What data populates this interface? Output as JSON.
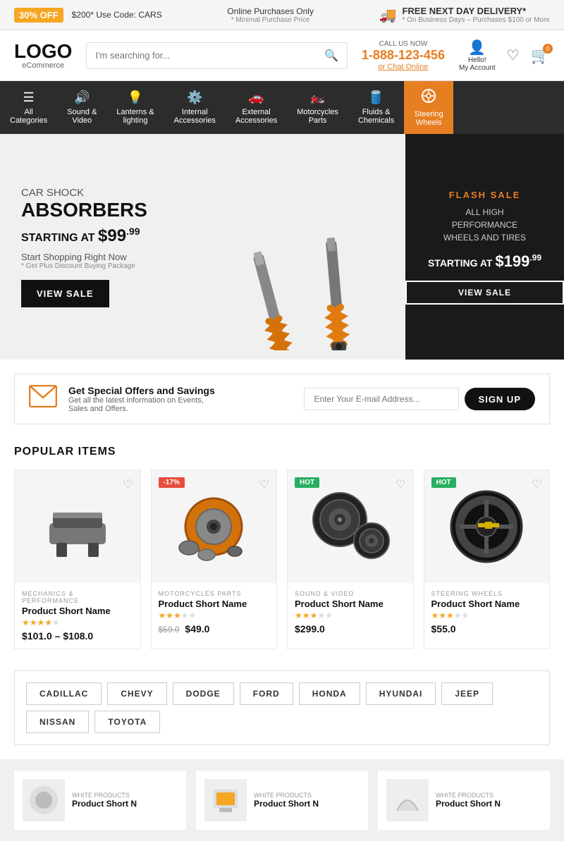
{
  "topBanner": {
    "saleText": "30% OFF",
    "promoCode": "$200* Use Code: CARS",
    "onlinePurchases": "Online Purchases Only",
    "minPurchase": "* Minimal Purchase Price",
    "deliveryTitle": "FREE NEXT DAY DELIVERY*",
    "deliveryNote": "* On Business Days – Purchases $100 or More",
    "truckIcon": "🚚"
  },
  "header": {
    "logoText": "LOGO",
    "logoSub": "eCommerce",
    "searchPlaceholder": "I'm searching for...",
    "callLabel": "CALL US NOW",
    "phone": "1-888-123-456",
    "chatLabel": "or Chat Online",
    "helloLabel": "Hello!",
    "myAccount": "My Account",
    "cartCount": "0",
    "personIcon": "👤",
    "heartIcon": "♡",
    "cartIcon": "🛒"
  },
  "nav": {
    "items": [
      {
        "label": "All\nCategories",
        "icon": "☰",
        "name": "all-categories"
      },
      {
        "label": "Sound &\nVideo",
        "icon": "🔊",
        "name": "sound-video"
      },
      {
        "label": "Lanterns &\nlighting",
        "icon": "💡",
        "name": "lanterns-lighting"
      },
      {
        "label": "Internal\nAccessories",
        "icon": "🔘",
        "name": "internal-accessories"
      },
      {
        "label": "External\nAccessories",
        "icon": "🚗",
        "name": "external-accessories"
      },
      {
        "label": "Motorcycles\nParts",
        "icon": "🚲",
        "name": "motorcycles-parts"
      },
      {
        "label": "Fluids &\nChemicals",
        "icon": "🔧",
        "name": "fluids-chemicals"
      },
      {
        "label": "Steering\nWheels",
        "icon": "⊙",
        "name": "steering-wheels",
        "active": true
      }
    ]
  },
  "hero": {
    "left": {
      "subtitle": "CAR SHOCK",
      "title": "ABSORBERS",
      "pricePre": "STARTING AT ",
      "priceDollar": "$99",
      "priceCents": ".99",
      "tagline": "Start Shopping Right Now",
      "disclaimer": "* Get Plus Discount Buying Package",
      "btnLabel": "VIEW SALE"
    },
    "right": {
      "flashLabel": "FLASH SALE",
      "flashDesc": "ALL HIGH\nPERFORMANCE\nWHEELS AND TIRES",
      "priceLabel": "STARTING AT ",
      "priceDollar": "$199",
      "priceCents": ".99",
      "btnLabel": "VIEW SALE"
    }
  },
  "newsletter": {
    "heading": "Get Special Offers and Savings",
    "subtext": "Get all the latest information on Events,\nSales and Offers.",
    "inputPlaceholder": "Enter Your E-mail Address...",
    "btnLabel": "SIGN UP"
  },
  "popular": {
    "heading": "POPULAR ITEMS",
    "products": [
      {
        "badge": null,
        "category": "MECHANICS & PERFORMANCE",
        "name": "Product Short Name",
        "stars": 4,
        "totalStars": 5,
        "price": "$101.0 – $108.0",
        "oldPrice": null,
        "color": "#b0b0b0"
      },
      {
        "badge": "-17%",
        "badgeType": "sale",
        "category": "MOTORCYCLES PARTS",
        "name": "Product Short Name",
        "stars": 3,
        "totalStars": 5,
        "price": "$49.0",
        "oldPrice": "$59.0",
        "color": "#c0603a"
      },
      {
        "badge": "HOT",
        "badgeType": "hot",
        "category": "SOUND & VIDEO",
        "name": "Product Short Name",
        "stars": 3,
        "totalStars": 5,
        "price": "$299.0",
        "oldPrice": null,
        "color": "#333333"
      },
      {
        "badge": "HOT",
        "badgeType": "hot",
        "category": "STEERING WHEELS",
        "name": "Product Short Name",
        "stars": 3,
        "totalStars": 5,
        "price": "$55.0",
        "oldPrice": null,
        "color": "#111111"
      }
    ]
  },
  "brands": {
    "items": [
      "CADILLAC",
      "CHEVY",
      "DODGE",
      "FORD",
      "HONDA",
      "HYUNDAI",
      "JEEP",
      "NISSAN",
      "TOYOTA"
    ]
  },
  "bottomProducts": [
    {
      "label": "WHITE PRODUCTS",
      "name": "Product Short N"
    },
    {
      "label": "WHITE PRODUCTS",
      "name": "Product Short N"
    },
    {
      "label": "WHITE PRODUCTS",
      "name": "Product Short N"
    }
  ]
}
